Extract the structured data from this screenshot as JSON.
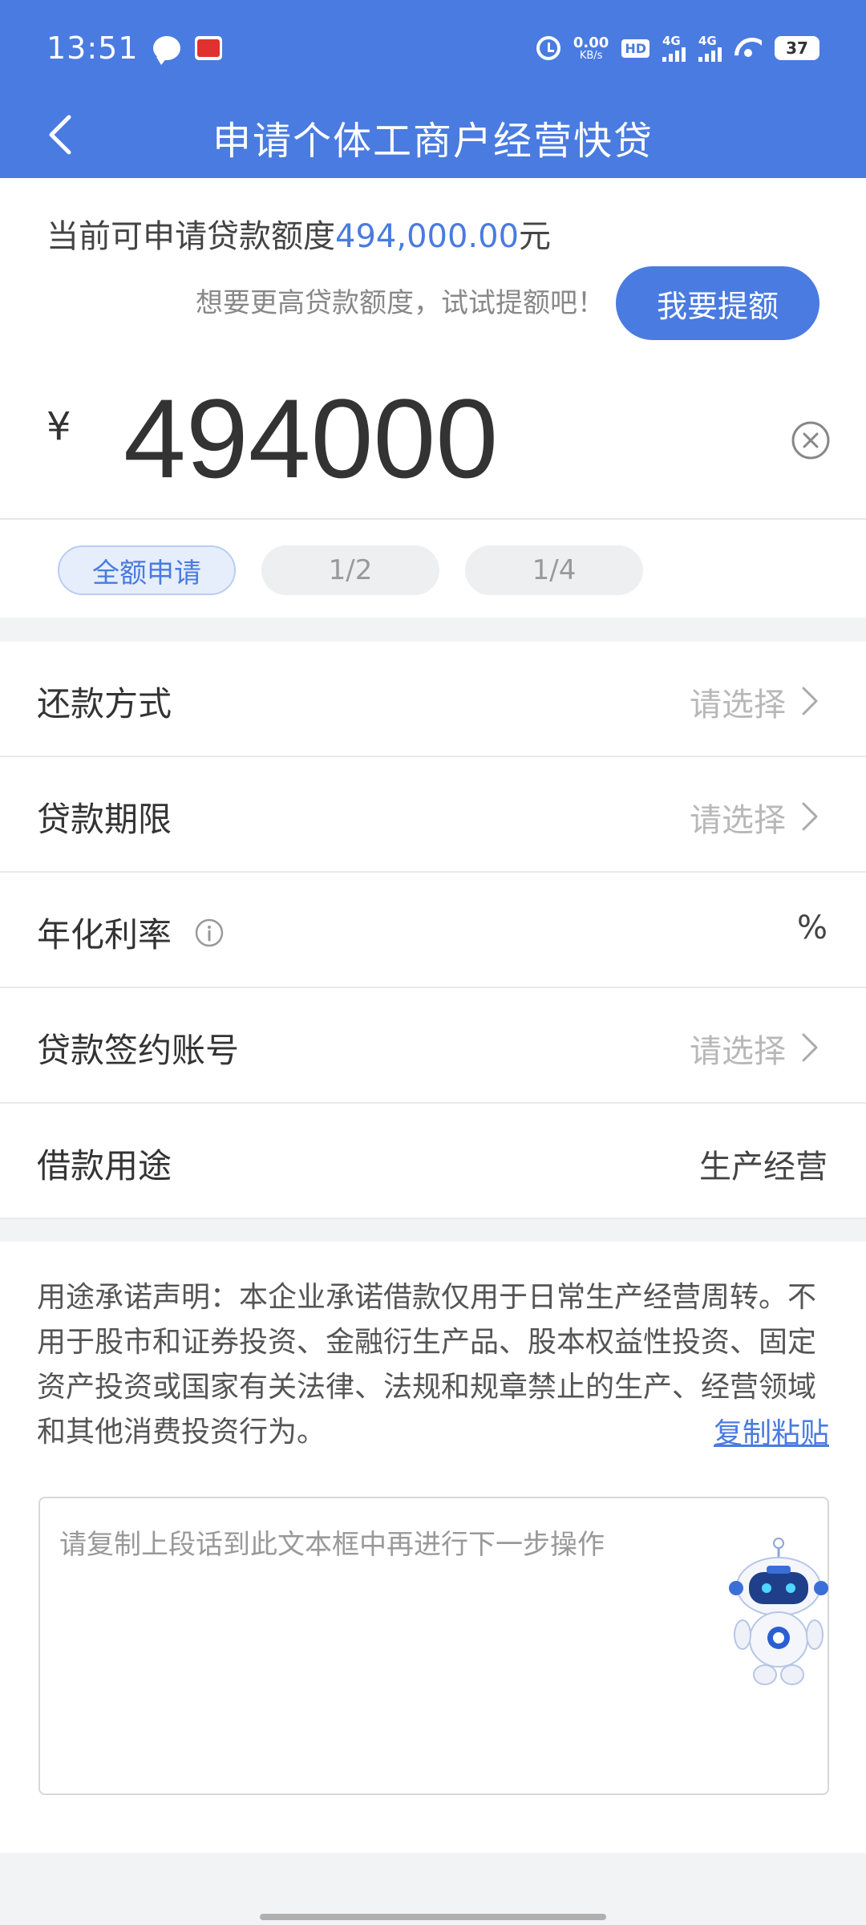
{
  "status_bar": {
    "time": "13:51",
    "speed_value": "0.00",
    "speed_unit": "KB/s",
    "hd_label": "HD",
    "network1": "4G",
    "network2": "4G",
    "battery": "37"
  },
  "nav": {
    "title": "申请个体工商户经营快贷"
  },
  "quota": {
    "prefix": "当前可申请贷款额度",
    "amount": "494,000.00",
    "suffix": "元",
    "raise_hint": "想要更高贷款额度，试试提额吧！",
    "raise_button": "我要提额",
    "currency": "¥",
    "input_value": "494000"
  },
  "presets": [
    {
      "label": "全额申请",
      "active": true
    },
    {
      "label": "1/2",
      "active": false
    },
    {
      "label": "1/4",
      "active": false
    }
  ],
  "form": {
    "repayment": {
      "label": "还款方式",
      "value": "请选择"
    },
    "term": {
      "label": "贷款期限",
      "value": "请选择"
    },
    "rate": {
      "label": "年化利率",
      "value": "%"
    },
    "account": {
      "label": "贷款签约账号",
      "value": "请选择"
    },
    "purpose": {
      "label": "借款用途",
      "value": "生产经营"
    }
  },
  "statement": {
    "text": "用途承诺声明：本企业承诺借款仅用于日常生产经营周转。不用于股市和证券投资、金融衍生产品、股本权益性投资、固定资产投资或国家有关法律、法规和规章禁止的生产、经营领域和其他消费投资行为。",
    "copy_link": "复制粘贴",
    "placeholder": "请复制上段话到此文本框中再进行下一步操作"
  },
  "colors": {
    "primary": "#4a7be0",
    "background": "#f2f3f5"
  }
}
